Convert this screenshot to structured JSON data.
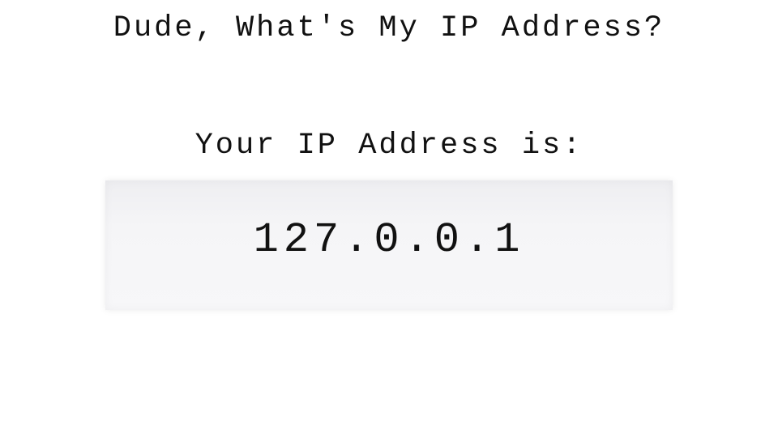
{
  "header": {
    "title": "Dude, What's My IP Address?"
  },
  "main": {
    "label": "Your IP Address is:",
    "ip_address": "127.0.0.1"
  }
}
